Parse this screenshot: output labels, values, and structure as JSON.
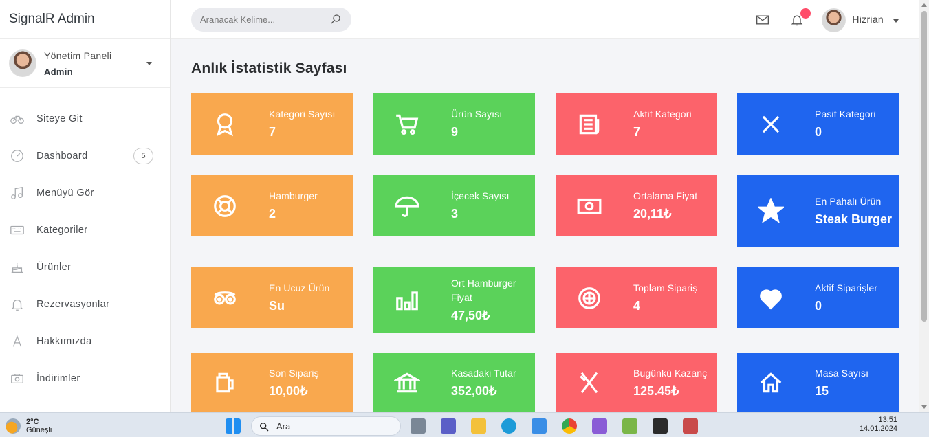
{
  "brand": "SignalR Admin",
  "profile": {
    "name": "Yönetim Paneli",
    "role": "Admin"
  },
  "nav": [
    {
      "label": "Siteye Git",
      "icon": "bicycle-icon"
    },
    {
      "label": "Dashboard",
      "icon": "gauge-icon",
      "badge": "5"
    },
    {
      "label": "Menüyü Gör",
      "icon": "music-note-icon"
    },
    {
      "label": "Kategoriler",
      "icon": "keyboard-icon"
    },
    {
      "label": "Ürünler",
      "icon": "cake-icon"
    },
    {
      "label": "Rezervasyonlar",
      "icon": "bell-icon"
    },
    {
      "label": "Hakkımızda",
      "icon": "letter-a-icon"
    },
    {
      "label": "İndirimler",
      "icon": "camera-icon"
    }
  ],
  "topbar": {
    "search_placeholder": "Aranacak Kelime...",
    "user_name": "Hizrian"
  },
  "page_title": "Anlık İstatistik Sayfası",
  "cards": [
    {
      "label": "Kategori Sayısı",
      "value": "7",
      "color": "#f9a84e",
      "icon": "award-icon"
    },
    {
      "label": "Ürün Sayısı",
      "value": "9",
      "color": "#5bd25a",
      "icon": "cart-icon"
    },
    {
      "label": "Aktif Kategori",
      "value": "7",
      "color": "#fc636b",
      "icon": "newspaper-icon"
    },
    {
      "label": "Pasif Kategori",
      "value": "0",
      "color": "#1f65ef",
      "icon": "close-icon"
    },
    {
      "label": "Hamburger",
      "value": "2",
      "color": "#f9a84e",
      "icon": "lifebuoy-icon"
    },
    {
      "label": "İçecek Sayısı",
      "value": "3",
      "color": "#5bd25a",
      "icon": "umbrella-icon"
    },
    {
      "label": "Ortalama Fiyat",
      "value": "20,11₺",
      "color": "#fc636b",
      "icon": "money-icon"
    },
    {
      "label": "En Pahalı Ürün",
      "value": "Steak Burger",
      "color": "#1f65ef",
      "icon": "star-icon"
    },
    {
      "label": "En Ucuz Ürün",
      "value": "Su",
      "color": "#f9a84e",
      "icon": "tripadvisor-icon"
    },
    {
      "label": "Ort Hamburger Fiyat",
      "value": "47,50₺",
      "color": "#5bd25a",
      "icon": "bar-chart-icon"
    },
    {
      "label": "Toplam Sipariş",
      "value": "4",
      "color": "#fc636b",
      "icon": "tire-icon"
    },
    {
      "label": "Aktif Siparişler",
      "value": "0",
      "color": "#1f65ef",
      "icon": "heart-icon"
    },
    {
      "label": "Son Sipariş",
      "value": "10,00₺",
      "color": "#f9a84e",
      "icon": "beer-mug-icon"
    },
    {
      "label": "Kasadaki Tutar",
      "value": "352,00₺",
      "color": "#5bd25a",
      "icon": "bank-icon"
    },
    {
      "label": "Bugünkü Kazanç",
      "value": "125.45₺",
      "color": "#fc636b",
      "icon": "utensils-icon"
    },
    {
      "label": "Masa Sayısı",
      "value": "15",
      "color": "#1f65ef",
      "icon": "home-icon"
    }
  ],
  "taskbar": {
    "weather_temp": "2°C",
    "weather_desc": "Güneşli",
    "search_label": "Ara",
    "time": "13:51",
    "date": "14.01.2024"
  }
}
